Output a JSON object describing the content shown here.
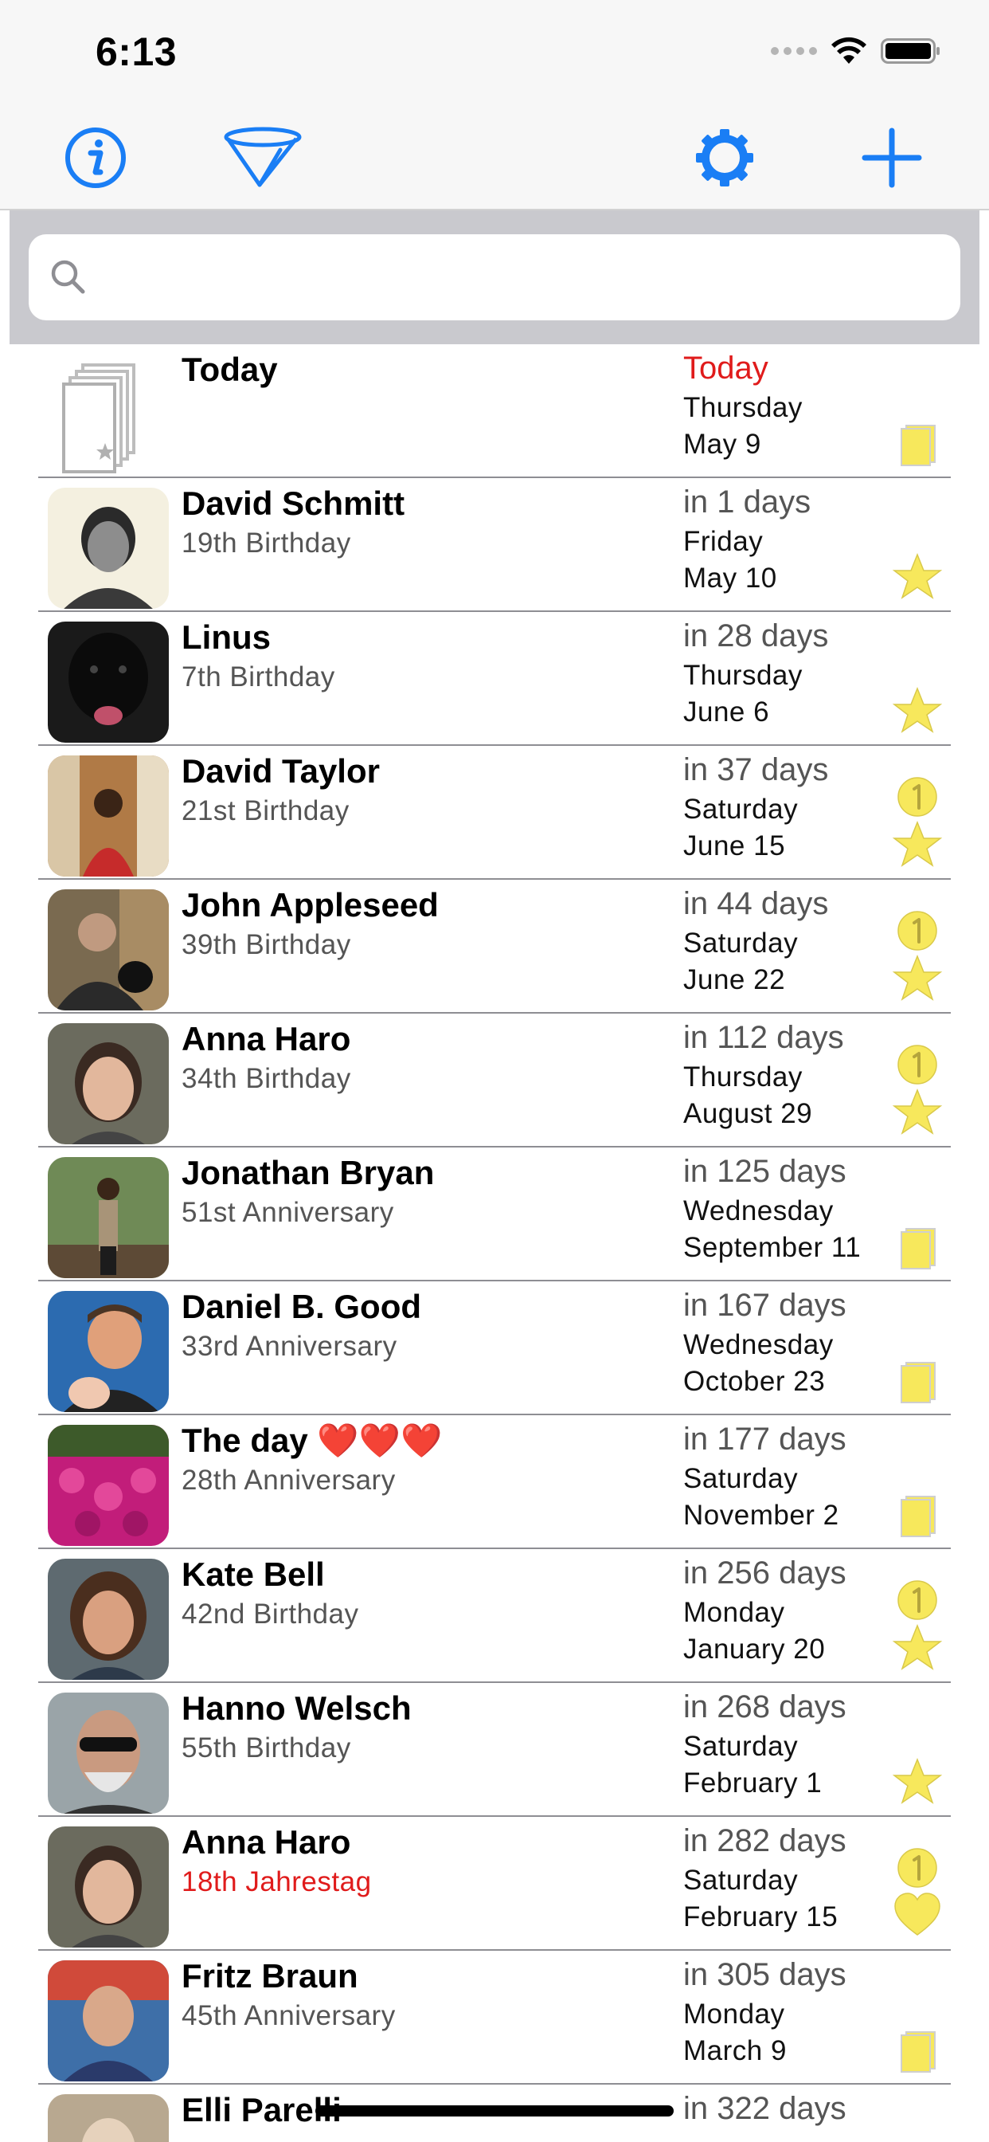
{
  "status_bar": {
    "time": "6:13"
  },
  "toolbar": {
    "info": "info-icon",
    "filter": "filter-icon",
    "settings": "gear-icon",
    "add": "plus-icon"
  },
  "search": {
    "placeholder": "",
    "value": ""
  },
  "colors": {
    "accent": "#1a7ef5",
    "today_red": "#e01b1b",
    "badge_yellow": "#f7e85c"
  },
  "events": [
    {
      "name": "Today",
      "subtitle": "",
      "when": "Today",
      "weekday": "Thursday",
      "date": "May 9",
      "badges": [
        "calendar-icon"
      ],
      "when_red": true,
      "avatar": "today-cards"
    },
    {
      "name": "David Schmitt",
      "subtitle": "19th Birthday",
      "when": "in 1 days",
      "weekday": "Friday",
      "date": "May 10",
      "badges": [
        "star-icon"
      ],
      "avatar": "photo"
    },
    {
      "name": "Linus",
      "subtitle": "7th Birthday",
      "when": "in 28 days",
      "weekday": "Thursday",
      "date": "June 6",
      "badges": [
        "star-icon"
      ],
      "avatar": "photo"
    },
    {
      "name": "David Taylor",
      "subtitle": "21st Birthday",
      "when": "in 37 days",
      "weekday": "Saturday",
      "date": "June 15",
      "badges": [
        "one-circle-icon",
        "star-icon"
      ],
      "avatar": "photo"
    },
    {
      "name": "John Appleseed",
      "subtitle": "39th Birthday",
      "when": "in 44 days",
      "weekday": "Saturday",
      "date": "June 22",
      "badges": [
        "one-circle-icon",
        "star-icon"
      ],
      "avatar": "photo"
    },
    {
      "name": "Anna Haro",
      "subtitle": "34th Birthday",
      "when": "in 112 days",
      "weekday": "Thursday",
      "date": "August 29",
      "badges": [
        "one-circle-icon",
        "star-icon"
      ],
      "avatar": "photo"
    },
    {
      "name": "Jonathan Bryan",
      "subtitle": "51st Anniversary",
      "when": "in 125 days",
      "weekday": "Wednesday",
      "date": "September 11",
      "badges": [
        "calendar-icon"
      ],
      "avatar": "photo"
    },
    {
      "name": "Daniel B. Good",
      "subtitle": "33rd Anniversary",
      "when": "in 167 days",
      "weekday": "Wednesday",
      "date": "October 23",
      "badges": [
        "calendar-icon"
      ],
      "avatar": "photo"
    },
    {
      "name": "The day ❤️❤️❤️",
      "subtitle": "28th Anniversary",
      "when": "in 177 days",
      "weekday": "Saturday",
      "date": "November 2",
      "badges": [
        "calendar-icon"
      ],
      "avatar": "photo"
    },
    {
      "name": "Kate Bell",
      "subtitle": "42nd Birthday",
      "when": "in 256 days",
      "weekday": "Monday",
      "date": "January 20",
      "badges": [
        "one-circle-icon",
        "star-icon"
      ],
      "avatar": "photo"
    },
    {
      "name": "Hanno Welsch",
      "subtitle": "55th Birthday",
      "when": "in 268 days",
      "weekday": "Saturday",
      "date": "February 1",
      "badges": [
        "star-icon"
      ],
      "avatar": "photo"
    },
    {
      "name": "Anna Haro",
      "subtitle": "18th Jahrestag",
      "subtitle_red": true,
      "when": "in 282 days",
      "weekday": "Saturday",
      "date": "February 15",
      "badges": [
        "one-circle-icon",
        "heart-icon"
      ],
      "avatar": "photo"
    },
    {
      "name": "Fritz Braun",
      "subtitle": "45th Anniversary",
      "when": "in 305 days",
      "weekday": "Monday",
      "date": "March 9",
      "badges": [
        "calendar-icon"
      ],
      "avatar": "photo"
    },
    {
      "name": "Elli Parelli",
      "subtitle": "",
      "when": "in 322 days",
      "weekday": "",
      "date": "",
      "badges": [],
      "avatar": "photo"
    }
  ]
}
